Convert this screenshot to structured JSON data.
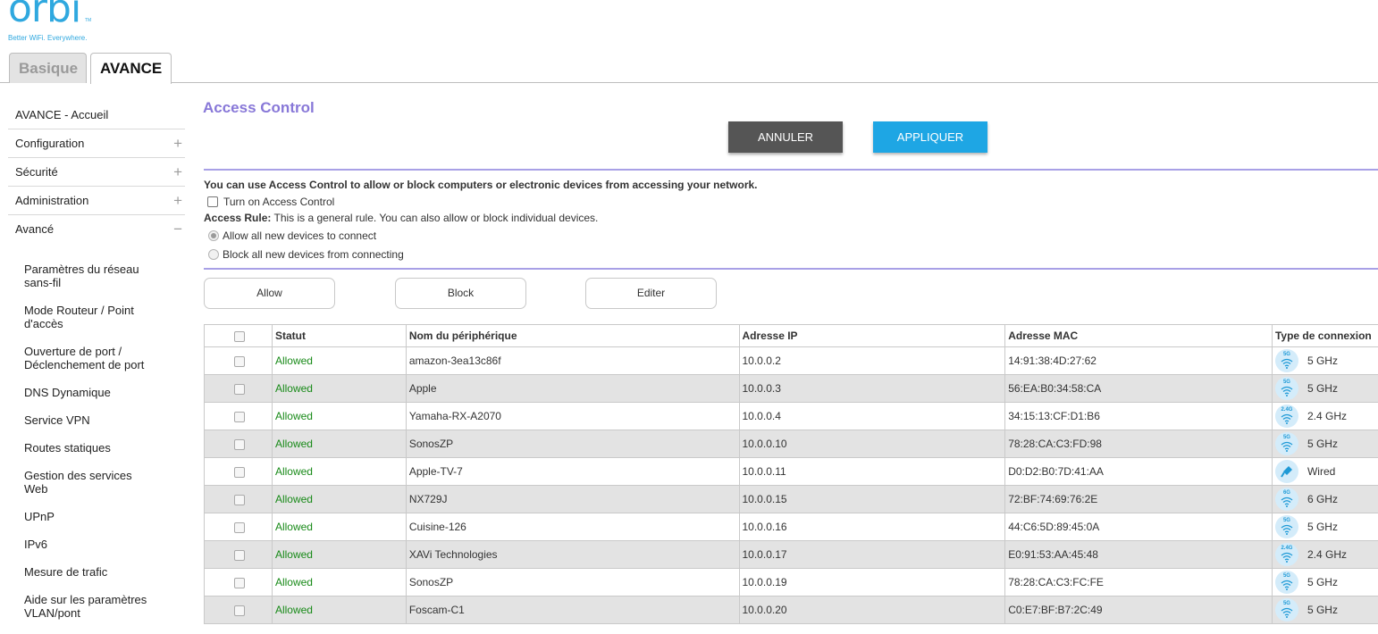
{
  "brand": {
    "logo_text": "orbi",
    "tm": "TM",
    "tagline": "Better WiFi. Everywhere."
  },
  "tabs": [
    {
      "label": "Basique",
      "active": false
    },
    {
      "label": "AVANCE",
      "active": true
    }
  ],
  "sidebar": {
    "items": [
      {
        "label": "AVANCE - Accueil",
        "expander": ""
      },
      {
        "label": "Configuration",
        "expander": "+"
      },
      {
        "label": "Sécurité",
        "expander": "+"
      },
      {
        "label": "Administration",
        "expander": "+"
      },
      {
        "label": "Avancé",
        "expander": "−"
      }
    ],
    "sub_items": [
      "Paramètres du réseau sans-fil",
      "Mode Routeur / Point d'accès",
      "Ouverture de port / Déclenchement de port",
      "DNS Dynamique",
      "Service VPN",
      "Routes statiques",
      "Gestion des services Web",
      "UPnP",
      "IPv6",
      "Mesure de trafic",
      "Aide sur les paramètres VLAN/pont"
    ]
  },
  "main": {
    "title": "Access Control",
    "cancel_label": "ANNULER",
    "apply_label": "APPLIQUER",
    "description": "You can use Access Control to allow or block computers or electronic devices from accessing your network.",
    "turn_on_label": "Turn on Access Control",
    "access_rule_label": "Access Rule:",
    "access_rule_text": " This is a general rule. You can also allow or block individual devices.",
    "radio_allow": "Allow all new devices to connect",
    "radio_block": "Block all new devices from connecting",
    "allow_label": "Allow",
    "block_label": "Block",
    "edit_label": "Editer"
  },
  "table": {
    "headers": {
      "status": "Statut",
      "name": "Nom du périphérique",
      "ip": "Adresse IP",
      "mac": "Adresse MAC",
      "type": "Type de connexion"
    },
    "rows": [
      {
        "status": "Allowed",
        "name": "amazon-3ea13c86f",
        "ip": "10.0.0.2",
        "mac": "14:91:38:4D:27:62",
        "band": "5G",
        "type": "5 GHz"
      },
      {
        "status": "Allowed",
        "name": "Apple",
        "ip": "10.0.0.3",
        "mac": "56:EA:B0:34:58:CA",
        "band": "5G",
        "type": "5 GHz"
      },
      {
        "status": "Allowed",
        "name": "Yamaha-RX-A2070",
        "ip": "10.0.0.4",
        "mac": "34:15:13:CF:D1:B6",
        "band": "2.4G",
        "type": "2.4 GHz"
      },
      {
        "status": "Allowed",
        "name": "SonosZP",
        "ip": "10.0.0.10",
        "mac": "78:28:CA:C3:FD:98",
        "band": "5G",
        "type": "5 GHz"
      },
      {
        "status": "Allowed",
        "name": "Apple-TV-7",
        "ip": "10.0.0.11",
        "mac": "D0:D2:B0:7D:41:AA",
        "band": "",
        "type": "Wired"
      },
      {
        "status": "Allowed",
        "name": "NX729J",
        "ip": "10.0.0.15",
        "mac": "72:BF:74:69:76:2E",
        "band": "6G",
        "type": "6 GHz"
      },
      {
        "status": "Allowed",
        "name": "Cuisine-126",
        "ip": "10.0.0.16",
        "mac": "44:C6:5D:89:45:0A",
        "band": "5G",
        "type": "5 GHz"
      },
      {
        "status": "Allowed",
        "name": "XAVi Technologies",
        "ip": "10.0.0.17",
        "mac": "E0:91:53:AA:45:48",
        "band": "2.4G",
        "type": "2.4 GHz"
      },
      {
        "status": "Allowed",
        "name": "SonosZP",
        "ip": "10.0.0.19",
        "mac": "78:28:CA:C3:FC:FE",
        "band": "5G",
        "type": "5 GHz"
      },
      {
        "status": "Allowed",
        "name": "Foscam-C1",
        "ip": "10.0.0.20",
        "mac": "C0:E7:BF:B7:2C:49",
        "band": "5G",
        "type": "5 GHz"
      }
    ]
  },
  "colors": {
    "brand": "#2fa8df",
    "title": "#8878d8",
    "apply": "#1ea6e4",
    "cancel": "#555555",
    "allowed": "#188a18",
    "divider": "#a8a0e6"
  }
}
